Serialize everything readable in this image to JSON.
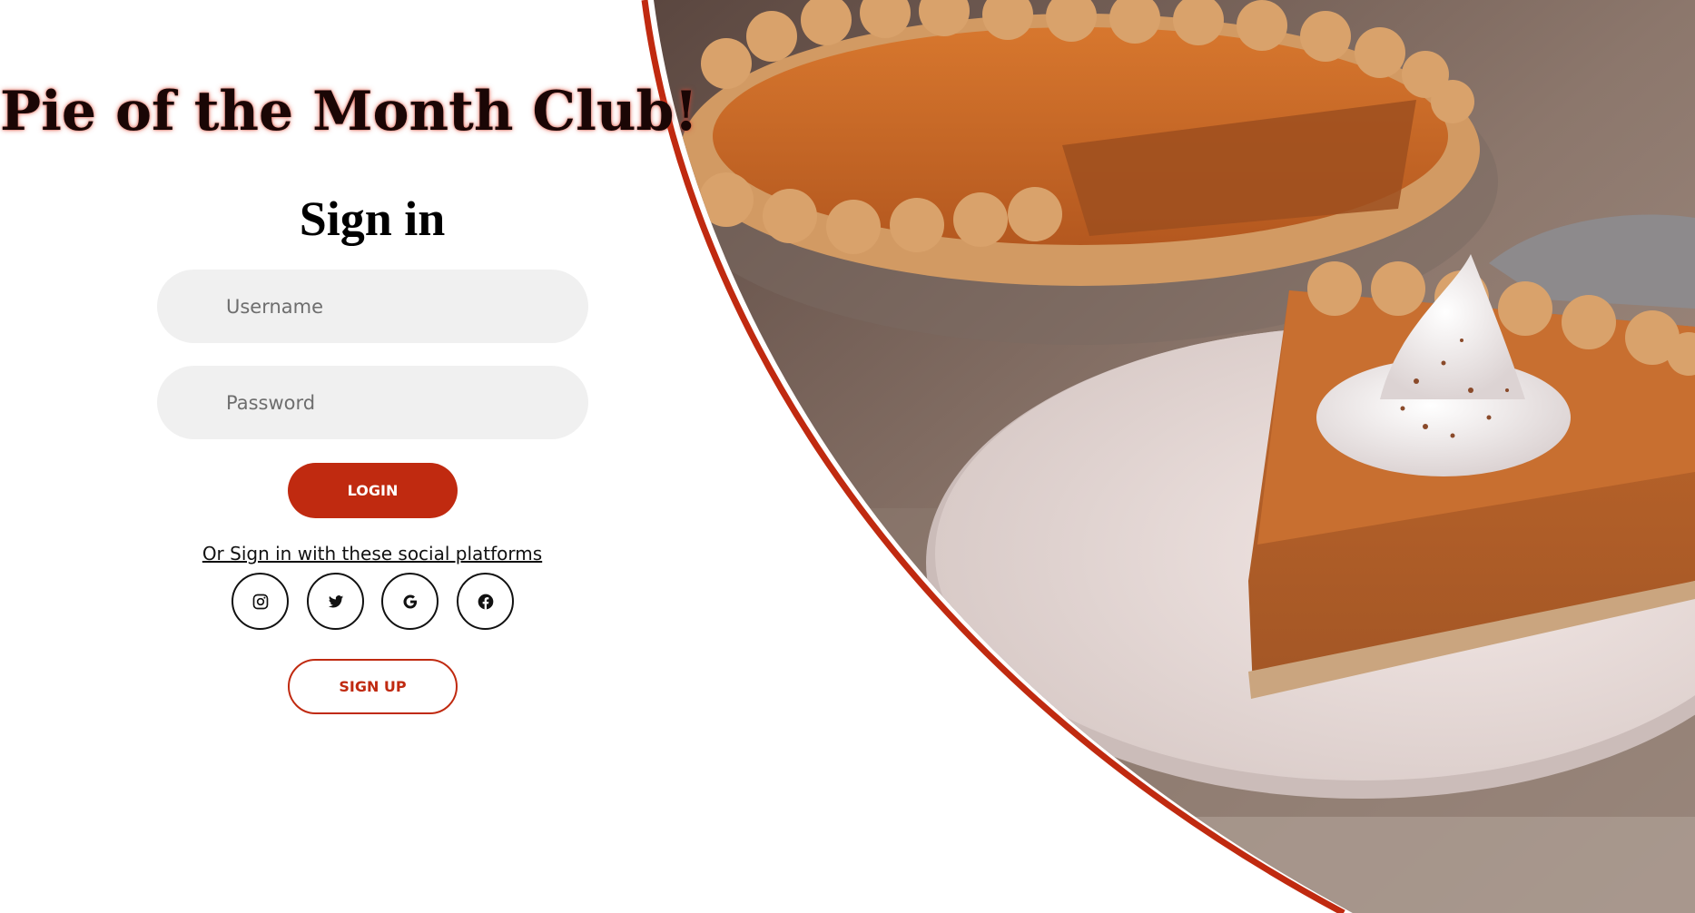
{
  "header": {
    "club_title": "Pie of the Month Club!"
  },
  "signin": {
    "title": "Sign in",
    "username_placeholder": "Username",
    "password_placeholder": "Password",
    "login_label": "LOGIN",
    "social_text": "Or Sign in with these social platforms",
    "social_icons": [
      "instagram-icon",
      "twitter-icon",
      "google-icon",
      "facebook-icon"
    ],
    "signup_label": "SIGN UP"
  },
  "theme": {
    "accent": "#c02a10",
    "field_bg": "#f0f0f0",
    "background": "#ffffff"
  },
  "hero": {
    "image_subject": "pumpkin-pie-photo"
  }
}
